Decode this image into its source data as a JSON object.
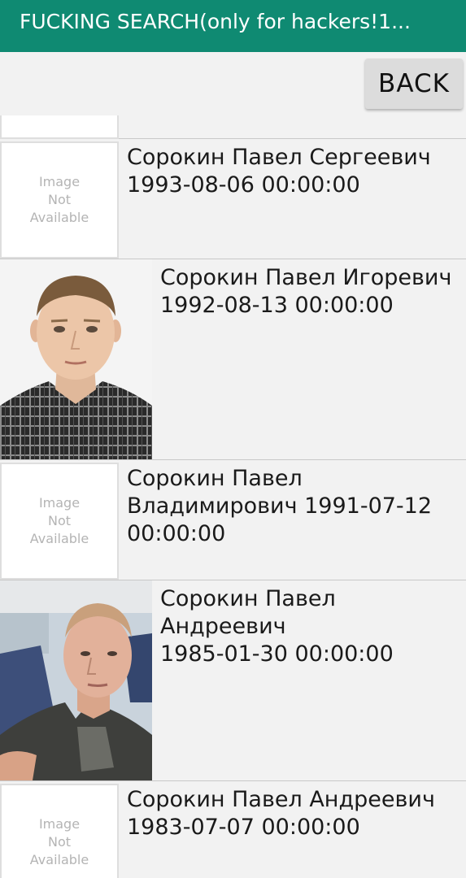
{
  "app_bar": {
    "title": "FUCKING SEARCH(only for hackers!1..."
  },
  "toolbar": {
    "back_label": "BACK"
  },
  "placeholder": {
    "line1": "Image",
    "line2": "Not",
    "line3": "Available"
  },
  "results": [
    {
      "line1": "Сорокин Павел Сергеевич",
      "line2": "1993-08-06 00:00:00",
      "photo": false
    },
    {
      "line1": "Сорокин Павел Игоревич",
      "line2": "1992-08-13 00:00:00",
      "photo": true
    },
    {
      "line1": "Сорокин Павел",
      "line2": "Владимирович 1991-07-12",
      "line3": "00:00:00",
      "photo": false
    },
    {
      "line1": "Сорокин Павел Андреевич",
      "line2": "1985-01-30 00:00:00",
      "photo": true
    },
    {
      "line1": "Сорокин Павел Андреевич",
      "line2": "1983-07-07 00:00:00",
      "photo": false
    }
  ]
}
